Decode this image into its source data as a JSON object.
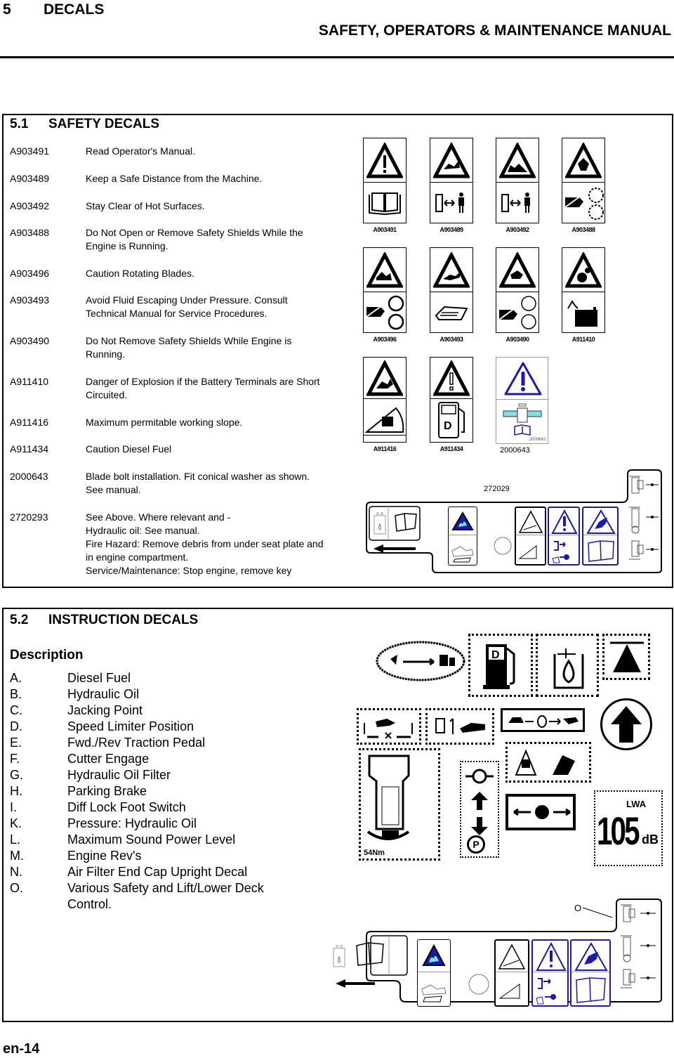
{
  "header": {
    "chapter_number": "5",
    "chapter_title": "DECALS",
    "manual_title": "SAFETY, OPERATORS & MAINTENANCE  MANUAL"
  },
  "safety_section": {
    "number": "5.1",
    "title": "SAFETY DECALS",
    "rows": [
      {
        "code": "A903491",
        "description": "Read Operator's Manual."
      },
      {
        "code": "A903489",
        "description": "Keep a Safe Distance from the Machine."
      },
      {
        "code": "A903492",
        "description": "Stay Clear of Hot Surfaces."
      },
      {
        "code": "A903488",
        "description": "Do Not Open or Remove Safety Shields While the Engine is Running."
      },
      {
        "code": "A903496",
        "description": "Caution Rotating Blades."
      },
      {
        "code": "A903493",
        "description": "Avoid Fluid Escaping Under Pressure.  Consult Technical Manual for Service Procedures."
      },
      {
        "code": "A903490",
        "description": "Do Not Remove Safety Shields While Engine is Running."
      },
      {
        "code": "A911410",
        "description": "Danger of Explosion if the Battery Terminals are Short Circuited."
      },
      {
        "code": "A911416",
        "description": "Maximum permitable working slope."
      },
      {
        "code": "A911434",
        "description": "Caution Diesel Fuel"
      },
      {
        "code": "2000643",
        "description": "Blade bolt installation. Fit conical washer as shown.  See manual."
      },
      {
        "code": "2720293",
        "description": "See Above.  Where relevant and -\nHydraulic oil: See manual.\nFire Hazard: Remove debris from under seat plate and in engine compartment.\nService/Maintenance:  Stop engine, remove key"
      }
    ],
    "decal_images": {
      "row1_labels": [
        "A903491",
        "A903489",
        "A903492",
        "A903488"
      ],
      "row2_labels": [
        "A903496",
        "A903493",
        "A903490",
        "A911410"
      ],
      "row3_labels": [
        "A911416",
        "A911434"
      ],
      "blade_decal_label": "2000643",
      "blade_decal_small_label": "2000643",
      "panel_label": "272029"
    }
  },
  "instruction_section": {
    "number": "5.2",
    "title": "INSTRUCTION DECALS",
    "description_heading": "Description",
    "items": [
      {
        "letter": "A.",
        "text": "Diesel Fuel"
      },
      {
        "letter": "B.",
        "text": "Hydraulic Oil"
      },
      {
        "letter": "C.",
        "text": "Jacking Point"
      },
      {
        "letter": "D.",
        "text": "Speed Limiter Position"
      },
      {
        "letter": "E.",
        "text": "Fwd./Rev Traction Pedal"
      },
      {
        "letter": "F.",
        "text": "Cutter Engage"
      },
      {
        "letter": "G.",
        "text": "Hydraulic Oil Filter"
      },
      {
        "letter": "H.",
        "text": "Parking Brake"
      },
      {
        "letter": "I.",
        "text": "Diff Lock Foot Switch"
      },
      {
        "letter": "K.",
        "text": "Pressure: Hydraulic Oil"
      },
      {
        "letter": "L.",
        "text": "Maximum Sound Power Level"
      },
      {
        "letter": "M.",
        "text": "Engine Rev's"
      },
      {
        "letter": "N.",
        "text": "Air Filter End Cap Upright Decal"
      },
      {
        "letter": "O.",
        "text": "Various Safety and Lift/Lower Deck Control."
      }
    ],
    "decal_images": {
      "sound_level_value": "105",
      "sound_level_unit": "dB",
      "sound_level_symbol": "LWA",
      "filter_pressure_label": "54Nm",
      "parking_symbol": "P",
      "callout_o": "O"
    }
  },
  "colors": {
    "ink": "#000000",
    "decal_blue": "#1a1aa8",
    "decal_cyan": "#7fe0e6"
  },
  "footer": {
    "page_number": "en-14"
  }
}
